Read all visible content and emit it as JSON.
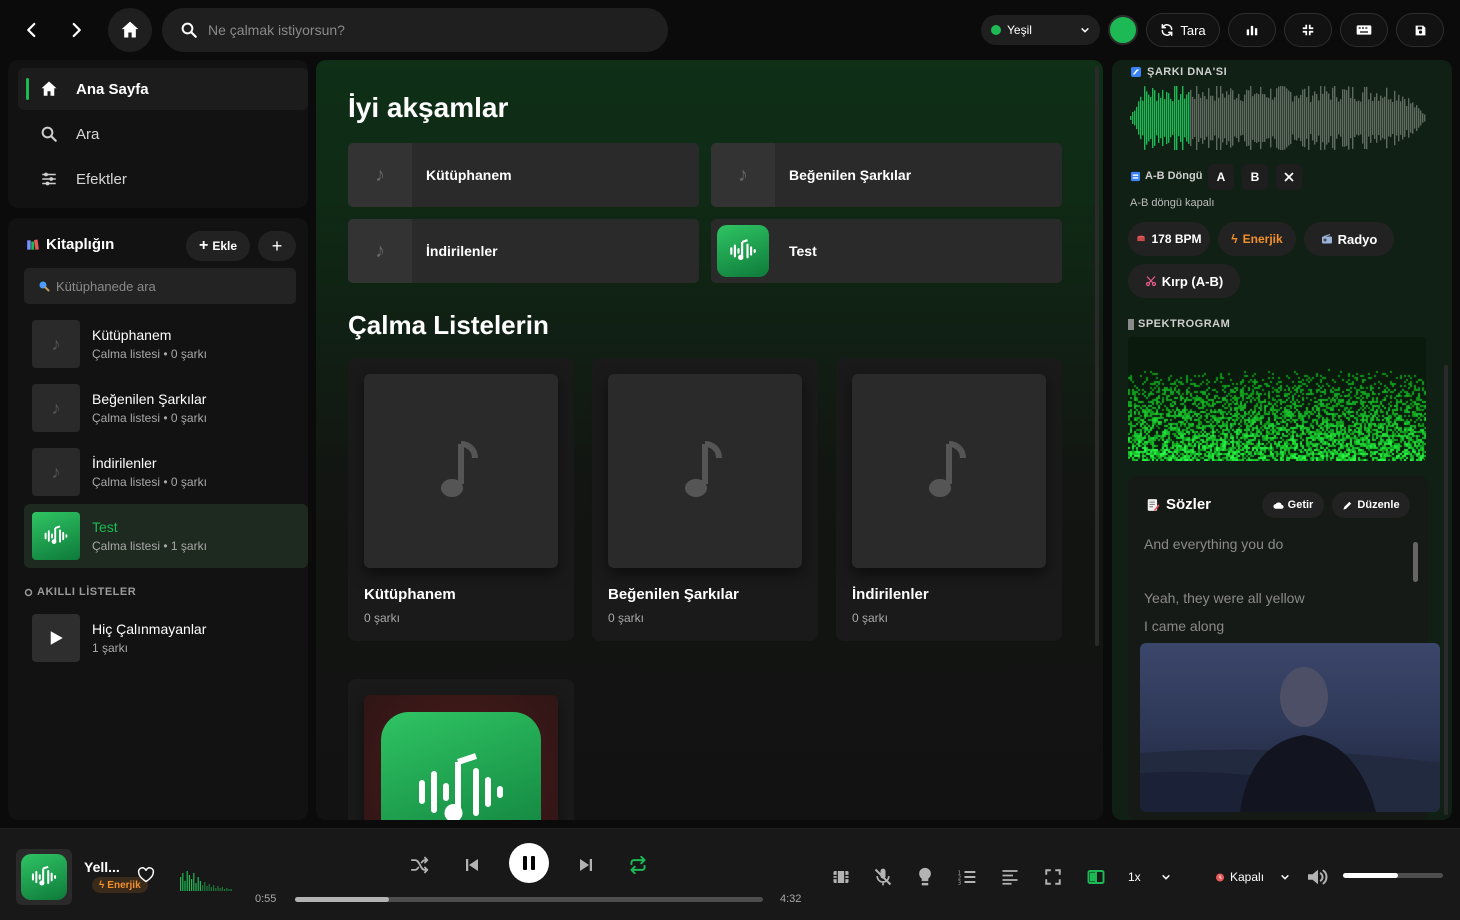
{
  "topbar": {
    "search_placeholder": "Ne çalmak istiyorsun?",
    "theme_label": "Yeşil",
    "scan_label": "Tara",
    "accent": "#1db954"
  },
  "sidebar": {
    "nav": [
      {
        "label": "Ana Sayfa",
        "icon": "home-icon"
      },
      {
        "label": "Ara",
        "icon": "search-icon"
      },
      {
        "label": "Efektler",
        "icon": "sliders-icon"
      }
    ],
    "library_title": "Kitaplığın",
    "add_label": "Ekle",
    "library_search_placeholder": "Kütüphanede ara",
    "items": [
      {
        "title": "Kütüphanem",
        "sub": "Çalma listesi • 0 şarkı"
      },
      {
        "title": "Beğenilen Şarkılar",
        "sub": "Çalma listesi • 0 şarkı"
      },
      {
        "title": "İndirilenler",
        "sub": "Çalma listesi • 0 şarkı"
      },
      {
        "title": "Test",
        "sub": "Çalma listesi • 1 şarkı"
      }
    ],
    "smart_title": "AKILLI LİSTELER",
    "smart_items": [
      {
        "title": "Hiç Çalınmayanlar",
        "sub": "1 şarkı"
      }
    ]
  },
  "main": {
    "greeting": "İyi akşamlar",
    "quick": [
      "Kütüphanem",
      "Beğenilen Şarkılar",
      "İndirilenler",
      "Test"
    ],
    "playlists_title": "Çalma Listelerin",
    "cards": [
      {
        "title": "Kütüphanem",
        "sub": "0 şarkı"
      },
      {
        "title": "Beğenilen Şarkılar",
        "sub": "0 şarkı"
      },
      {
        "title": "İndirilenler",
        "sub": "0 şarkı"
      }
    ]
  },
  "right": {
    "dna_title": "ŞARKI DNA'SI",
    "ab_label": "A-B Döngü",
    "a_label": "A",
    "b_label": "B",
    "ab_status": "A-B döngü kapalı",
    "bpm": "178 BPM",
    "mood": "Enerjik",
    "radio": "Radyo",
    "cut": "Kırp (A-B)",
    "spectro_title": "SPEKTROGRAM",
    "lyrics_title": "Sözler",
    "fetch_label": "Getir",
    "edit_label": "Düzenle",
    "lyrics": [
      "And everything you do",
      "Yeah, they were all yellow",
      "I came along"
    ]
  },
  "player": {
    "title": "Yell...",
    "mood": "Enerjik",
    "elapsed": "0:55",
    "duration": "4:32",
    "progress": 0.2,
    "speed": "1x",
    "sleep": "Kapalı",
    "volume": 0.55
  }
}
